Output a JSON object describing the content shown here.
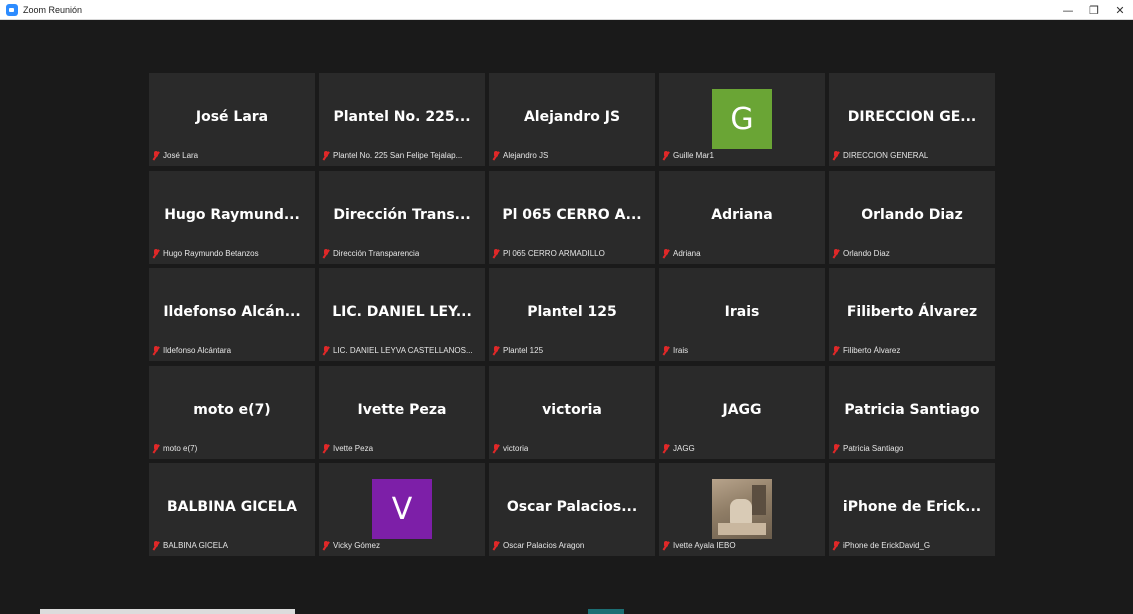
{
  "window": {
    "title": "Zoom Reunión",
    "minimize": "—",
    "restore": "❐",
    "close": "✕"
  },
  "colors": {
    "tile_background": "#2a2a2a",
    "stage_background": "#1a1a1a",
    "muted_icon": "#e02828",
    "avatar_g": "#6aa535",
    "avatar_v": "#7d1fa8"
  },
  "participants": [
    {
      "display": "José Lara",
      "caption": "José Lara"
    },
    {
      "display": "Plantel No. 225...",
      "caption": "Plantel No. 225 San Felipe Tejalap..."
    },
    {
      "display": "Alejandro JS",
      "caption": "Alejandro JS"
    },
    {
      "display": "G",
      "caption": "Guille Mar1"
    },
    {
      "display": "DIRECCION GE...",
      "caption": "DIRECCION GENERAL"
    },
    {
      "display": "Hugo Raymund...",
      "caption": "Hugo Raymundo Betanzos"
    },
    {
      "display": "Dirección Trans...",
      "caption": "Dirección Transparencia"
    },
    {
      "display": "Pl 065 CERRO A...",
      "caption": "Pl 065 CERRO ARMADILLO"
    },
    {
      "display": "Adriana",
      "caption": "Adriana"
    },
    {
      "display": "Orlando Diaz",
      "caption": "Orlando Diaz"
    },
    {
      "display": "Ildefonso Alcán...",
      "caption": "Ildefonso Alcántara"
    },
    {
      "display": "LIC. DANIEL LEY...",
      "caption": "LIC. DANIEL LEYVA CASTELLANOS..."
    },
    {
      "display": "Plantel 125",
      "caption": "Plantel 125"
    },
    {
      "display": "Irais",
      "caption": "Irais"
    },
    {
      "display": "Filiberto Álvarez",
      "caption": "Filiberto Álvarez"
    },
    {
      "display": "moto e(7)",
      "caption": "moto e(7)"
    },
    {
      "display": "Ivette Peza",
      "caption": "Ivette Peza"
    },
    {
      "display": "victoria",
      "caption": "victoria"
    },
    {
      "display": "JAGG",
      "caption": "JAGG"
    },
    {
      "display": "Patricia Santiago",
      "caption": "Patricia Santiago"
    },
    {
      "display": "BALBINA GICELA",
      "caption": "BALBINA GICELA"
    },
    {
      "display": "V",
      "caption": "Vicky Gómez"
    },
    {
      "display": "Oscar Palacios...",
      "caption": "Oscar Palacios Aragon"
    },
    {
      "display": "",
      "caption": "Ivette Ayala IEBO"
    },
    {
      "display": "iPhone de Erick...",
      "caption": "iPhone de ErickDavid_G"
    }
  ]
}
